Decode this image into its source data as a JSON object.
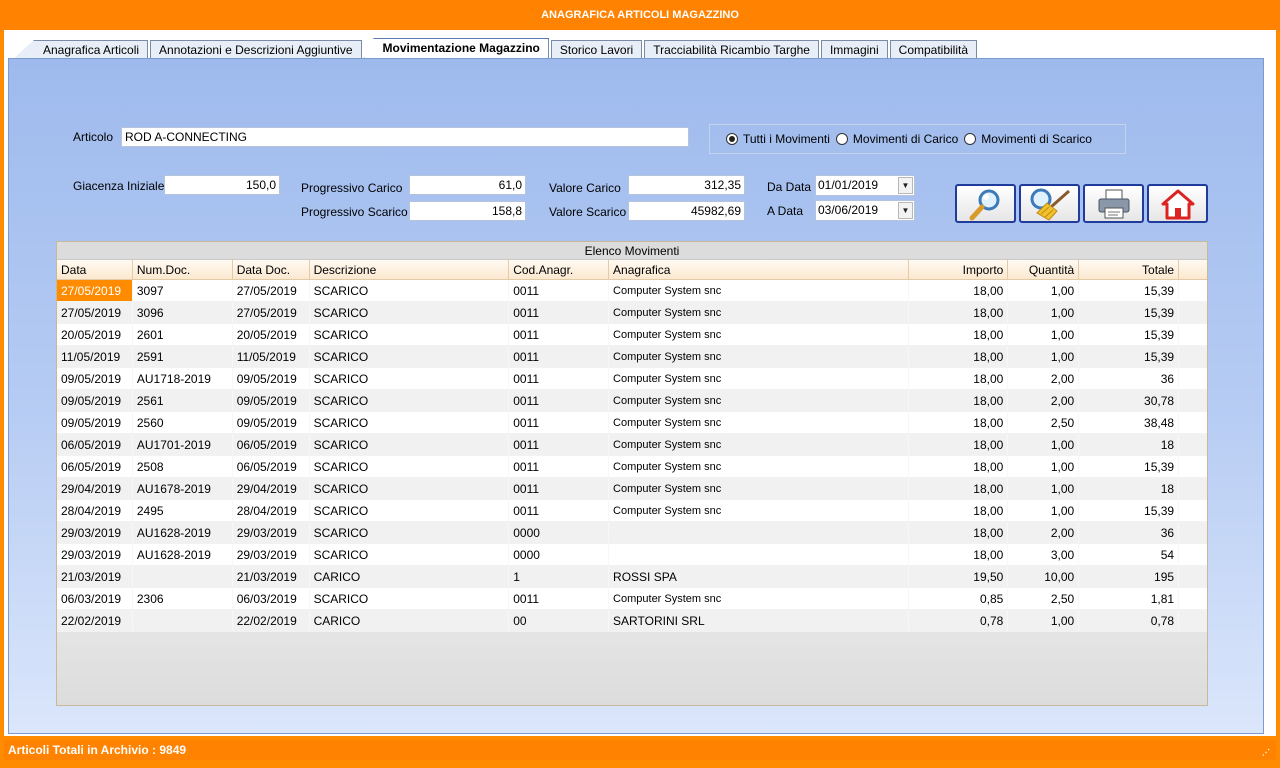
{
  "window": {
    "title": "ANAGRAFICA ARTICOLI MAGAZZINO"
  },
  "tabs": [
    {
      "label": "Anagrafica Articoli"
    },
    {
      "label": "Annotazioni  e Descrizioni Aggiuntive"
    },
    {
      "label": "Movimentazione Magazzino",
      "active": true
    },
    {
      "label": "Storico Lavori"
    },
    {
      "label": "Tracciabilità Ricambio Targhe"
    },
    {
      "label": "Immagini"
    },
    {
      "label": "Compatibilità"
    }
  ],
  "form": {
    "articolo_label": "Articolo",
    "articolo_value": "ROD A-CONNECTING",
    "giacenza_label": "Giacenza Iniziale",
    "giacenza_value": "150,0",
    "prog_carico_label": "Progressivo Carico",
    "prog_carico_value": "61,0",
    "prog_scarico_label": "Progressivo Scarico",
    "prog_scarico_value": "158,8",
    "val_carico_label": "Valore Carico",
    "val_carico_value": "312,35",
    "val_scarico_label": "Valore Scarico",
    "val_scarico_value": "45982,69",
    "da_data_label": "Da Data",
    "da_data_value": "01/01/2019",
    "a_data_label": "A Data",
    "a_data_value": "03/06/2019"
  },
  "filter": {
    "options": [
      {
        "label": "Tutti i Movimenti",
        "selected": true
      },
      {
        "label": "Movimenti di Carico",
        "selected": false
      },
      {
        "label": "Movimenti di Scarico",
        "selected": false
      }
    ]
  },
  "toolbar": {
    "buttons": [
      {
        "icon": "search-icon"
      },
      {
        "icon": "broom-icon"
      },
      {
        "icon": "printer-icon"
      },
      {
        "icon": "home-icon"
      }
    ]
  },
  "grid": {
    "caption": "Elenco Movimenti",
    "columns": [
      "Data",
      "Num.Doc.",
      "Data Doc.",
      "Descrizione",
      "Cod.Anagr.",
      "Anagrafica",
      "Importo",
      "Quantità",
      "Totale"
    ],
    "rows": [
      [
        "27/05/2019",
        "3097",
        "27/05/2019",
        "SCARICO",
        "0011",
        "Computer System snc",
        "18,00",
        "1,00",
        "15,39"
      ],
      [
        "27/05/2019",
        "3096",
        "27/05/2019",
        "SCARICO",
        "0011",
        "Computer System snc",
        "18,00",
        "1,00",
        "15,39"
      ],
      [
        "20/05/2019",
        "2601",
        "20/05/2019",
        "SCARICO",
        "0011",
        "Computer System snc",
        "18,00",
        "1,00",
        "15,39"
      ],
      [
        "11/05/2019",
        "2591",
        "11/05/2019",
        "SCARICO",
        "0011",
        "Computer System snc",
        "18,00",
        "1,00",
        "15,39"
      ],
      [
        "09/05/2019",
        "AU1718-2019",
        "09/05/2019",
        "SCARICO",
        "0011",
        "Computer System snc",
        "18,00",
        "2,00",
        "36"
      ],
      [
        "09/05/2019",
        "2561",
        "09/05/2019",
        "SCARICO",
        "0011",
        "Computer System snc",
        "18,00",
        "2,00",
        "30,78"
      ],
      [
        "09/05/2019",
        "2560",
        "09/05/2019",
        "SCARICO",
        "0011",
        "Computer System snc",
        "18,00",
        "2,50",
        "38,48"
      ],
      [
        "06/05/2019",
        "AU1701-2019",
        "06/05/2019",
        "SCARICO",
        "0011",
        "Computer System snc",
        "18,00",
        "1,00",
        "18"
      ],
      [
        "06/05/2019",
        "2508",
        "06/05/2019",
        "SCARICO",
        "0011",
        "Computer System snc",
        "18,00",
        "1,00",
        "15,39"
      ],
      [
        "29/04/2019",
        "AU1678-2019",
        "29/04/2019",
        "SCARICO",
        "0011",
        "Computer System snc",
        "18,00",
        "1,00",
        "18"
      ],
      [
        "28/04/2019",
        "2495",
        "28/04/2019",
        "SCARICO",
        "0011",
        "Computer System snc",
        "18,00",
        "1,00",
        "15,39"
      ],
      [
        "29/03/2019",
        "AU1628-2019",
        "29/03/2019",
        "SCARICO",
        "0000",
        "",
        "18,00",
        "2,00",
        "36"
      ],
      [
        "29/03/2019",
        "AU1628-2019",
        "29/03/2019",
        "SCARICO",
        "0000",
        "",
        "18,00",
        "3,00",
        "54"
      ],
      [
        "21/03/2019",
        "",
        "21/03/2019",
        "CARICO",
        "1",
        "ROSSI SPA",
        "19,50",
        "10,00",
        "195"
      ],
      [
        "06/03/2019",
        "2306",
        "06/03/2019",
        "SCARICO",
        "0011",
        "Computer System snc",
        "0,85",
        "2,50",
        "1,81"
      ],
      [
        "22/02/2019",
        "",
        "22/02/2019",
        "CARICO",
        "00",
        "SARTORINI SRL",
        "0,78",
        "1,00",
        "0,78"
      ]
    ]
  },
  "status": {
    "text": "Articoli Totali in Archivio : 9849"
  },
  "colors": {
    "accent": "#ff8200",
    "panel_top": "#9ebaed",
    "panel_bottom": "#dbe6fb"
  }
}
